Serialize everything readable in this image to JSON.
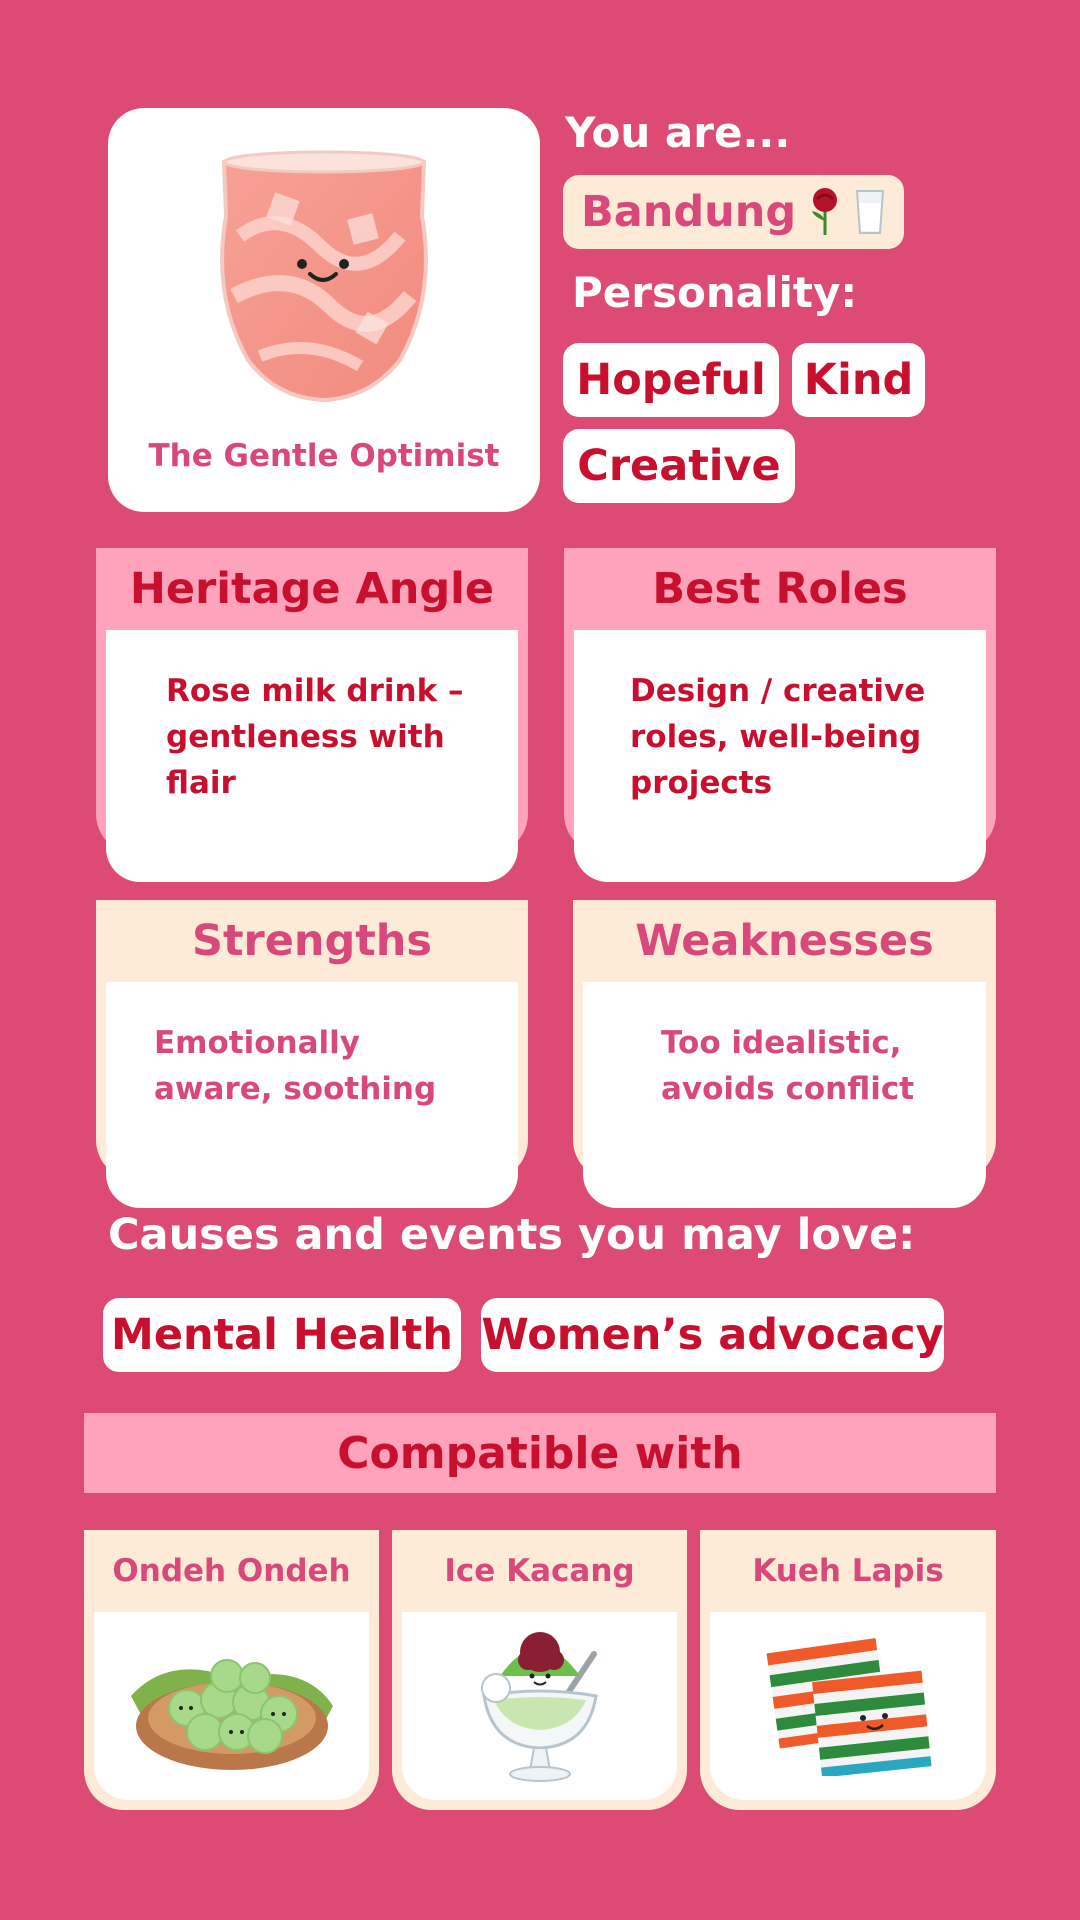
{
  "hero": {
    "caption": "The Gentle Optimist",
    "you_are": "You are...",
    "result": "Bandung",
    "result_icons": [
      "rose-icon",
      "milk-glass-icon"
    ],
    "personality_label": "Personality:",
    "traits": [
      "Hopeful",
      "Kind",
      "Creative"
    ]
  },
  "cards": {
    "heritage": {
      "title": "Heritage Angle",
      "text": "Rose milk drink – gentleness with flair"
    },
    "roles": {
      "title": "Best Roles",
      "text": "Design / creative roles, well-being projects"
    },
    "strengths": {
      "title": "Strengths",
      "text": "Emotionally aware, soothing"
    },
    "weaknesses": {
      "title": "Weaknesses",
      "text": "Too idealistic, avoids conflict"
    }
  },
  "causes": {
    "label": "Causes and events you may love:",
    "items": [
      "Mental Health",
      "Women’s advocacy"
    ]
  },
  "compatible": {
    "title": "Compatible with",
    "items": [
      {
        "name": "Ondeh Ondeh",
        "icon": "ondeh-ondeh-icon"
      },
      {
        "name": "Ice Kacang",
        "icon": "ice-kacang-icon"
      },
      {
        "name": "Kueh Lapis",
        "icon": "kueh-lapis-icon"
      }
    ]
  },
  "colors": {
    "background": "#dd4a73",
    "accent_red": "#c8102e",
    "accent_pink": "#d9487a",
    "light_pink": "#ffa2bc",
    "cream": "#fdebd7"
  }
}
